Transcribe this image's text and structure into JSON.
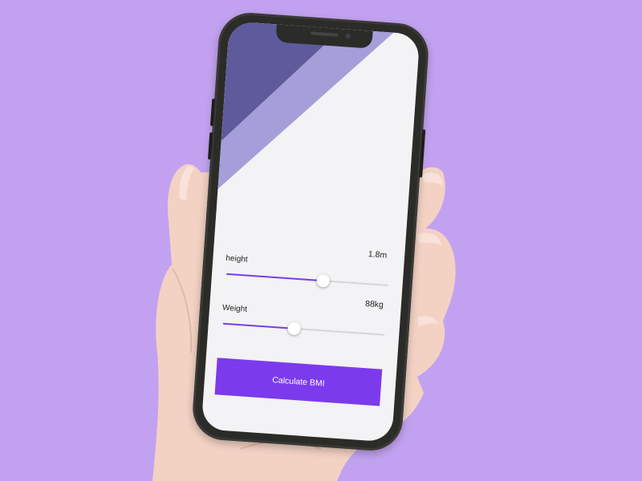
{
  "colors": {
    "background": "#c2a2f0",
    "accent": "#7c3aed",
    "stripe_dark": "#5f5a9b",
    "stripe_light": "#a49fd8",
    "screen": "#f3f2f4"
  },
  "height": {
    "label": "height",
    "value_text": "1.8m",
    "fraction": 0.6
  },
  "weight": {
    "label": "Weight",
    "value_text": "88kg",
    "fraction": 0.44
  },
  "calculate_button": {
    "label": "Calculate BMI"
  }
}
